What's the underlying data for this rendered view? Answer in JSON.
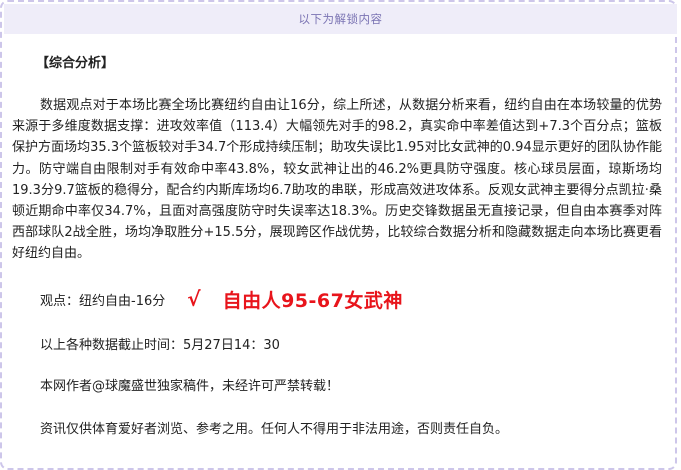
{
  "banner": {
    "text": "以下为解锁内容"
  },
  "article": {
    "section_title": "【综合分析】",
    "analysis": "数据观点对于本场比赛全场比赛纽约自由让16分，综上所述，从数据分析来看，纽约自由在本场较量的优势来源于多维度数据支撑：进攻效率值（113.4）大幅领先对手的98.2，真实命中率差值达到+7.3个百分点；篮板保护方面场均35.3个篮板较对手34.7个形成持续压制；助攻失误比1.95对比女武神的0.94显示更好的团队协作能力。防守端自由限制对手有效命中率43.8%，较女武神让出的46.2%更具防守强度。核心球员层面，琼斯场均19.3分9.7篮板的稳得分，配合约内斯库场均6.7助攻的串联，形成高效进攻体系。反观女武神主要得分点凯拉·桑顿近期命中率仅34.7%，且面对高强度防守时失误率达18.3%。历史交锋数据虽无直接记录，但自由本赛季对阵西部球队2战全胜，场均净取胜分+15.5分，展现跨区作战优势，比较综合数据分析和隐藏数据走向本场比赛更看好纽约自由。",
    "pick_label": "观点：纽约自由-16分",
    "check_mark": "√",
    "result": "自由人95-67女武神",
    "cutoff_time": "以上各种数据截止时间：5月27日14：30",
    "copyright": "本网作者@球魔盛世独家稿件，未经许可严禁转载！",
    "disclaimer": "资讯仅供体育爱好者浏览、参考之用。任何人不得用于非法用途，否则责任自负。"
  },
  "colors": {
    "banner_bg": "#efedf9",
    "banner_text": "#7a73b3",
    "frame_border": "#cdc6ea",
    "accent_red": "#e8141b",
    "body_text": "#222222"
  }
}
